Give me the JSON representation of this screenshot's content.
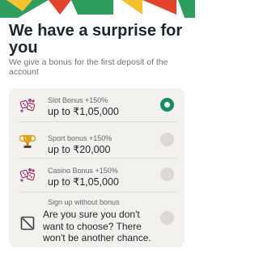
{
  "header": {
    "title": "We have a surprise for you",
    "subtitle": "We give a bonus for the first deposit of the account"
  },
  "options": [
    {
      "label": "Slot Bonus +150%",
      "amount": "up to ₹1,05,000",
      "icon": "slot-bonus-icon",
      "selected": true
    },
    {
      "label": "Sport bonus +150%",
      "amount": "up to ₹20,000",
      "icon": "trophy-icon",
      "selected": false
    },
    {
      "label": "Casino Bonus +150%",
      "amount": "up to ₹1,05,000",
      "icon": "casino-bonus-icon",
      "selected": false
    },
    {
      "label": "Sign up without bonus",
      "amount": "Are you sure you don't want to choose? There won't be another chance.",
      "icon": "no-bonus-icon",
      "selected": false
    }
  ],
  "colors": {
    "accent": "#1b8a6b",
    "card_bg": "#f2f1ee",
    "banner_green": "#2e9e5e",
    "banner_red": "#e4432b",
    "banner_yellow": "#f5c12c"
  }
}
